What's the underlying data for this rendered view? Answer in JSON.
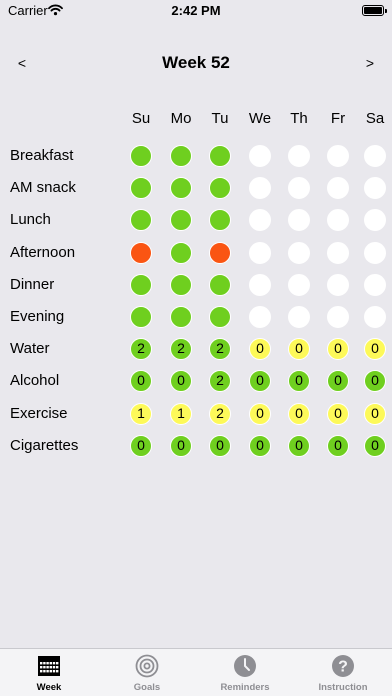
{
  "status_bar": {
    "carrier": "Carrier",
    "time": "2:42 PM"
  },
  "header": {
    "prev": "<",
    "title": "Week 52",
    "next": ">"
  },
  "days": [
    "Su",
    "Mo",
    "Tu",
    "We",
    "Th",
    "Fr",
    "Sa"
  ],
  "colors": {
    "green": "#6fcf1f",
    "red": "#fa5513",
    "yellow": "#fdf959",
    "empty": "#ffffff",
    "background": "#e9e8ed"
  },
  "rows": [
    {
      "label": "Breakfast",
      "cells": [
        {
          "s": "green",
          "v": ""
        },
        {
          "s": "green",
          "v": ""
        },
        {
          "s": "green",
          "v": ""
        },
        {
          "s": "empty",
          "v": ""
        },
        {
          "s": "empty",
          "v": ""
        },
        {
          "s": "empty",
          "v": ""
        },
        {
          "s": "empty",
          "v": ""
        }
      ]
    },
    {
      "label": "AM snack",
      "cells": [
        {
          "s": "green",
          "v": ""
        },
        {
          "s": "green",
          "v": ""
        },
        {
          "s": "green",
          "v": ""
        },
        {
          "s": "empty",
          "v": ""
        },
        {
          "s": "empty",
          "v": ""
        },
        {
          "s": "empty",
          "v": ""
        },
        {
          "s": "empty",
          "v": ""
        }
      ]
    },
    {
      "label": "Lunch",
      "cells": [
        {
          "s": "green",
          "v": ""
        },
        {
          "s": "green",
          "v": ""
        },
        {
          "s": "green",
          "v": ""
        },
        {
          "s": "empty",
          "v": ""
        },
        {
          "s": "empty",
          "v": ""
        },
        {
          "s": "empty",
          "v": ""
        },
        {
          "s": "empty",
          "v": ""
        }
      ]
    },
    {
      "label": "Afternoon",
      "cells": [
        {
          "s": "red",
          "v": ""
        },
        {
          "s": "green",
          "v": ""
        },
        {
          "s": "red",
          "v": ""
        },
        {
          "s": "empty",
          "v": ""
        },
        {
          "s": "empty",
          "v": ""
        },
        {
          "s": "empty",
          "v": ""
        },
        {
          "s": "empty",
          "v": ""
        }
      ]
    },
    {
      "label": "Dinner",
      "cells": [
        {
          "s": "green",
          "v": ""
        },
        {
          "s": "green",
          "v": ""
        },
        {
          "s": "green",
          "v": ""
        },
        {
          "s": "empty",
          "v": ""
        },
        {
          "s": "empty",
          "v": ""
        },
        {
          "s": "empty",
          "v": ""
        },
        {
          "s": "empty",
          "v": ""
        }
      ]
    },
    {
      "label": "Evening",
      "cells": [
        {
          "s": "green",
          "v": ""
        },
        {
          "s": "green",
          "v": ""
        },
        {
          "s": "green",
          "v": ""
        },
        {
          "s": "empty",
          "v": ""
        },
        {
          "s": "empty",
          "v": ""
        },
        {
          "s": "empty",
          "v": ""
        },
        {
          "s": "empty",
          "v": ""
        }
      ]
    },
    {
      "label": "Water",
      "cells": [
        {
          "s": "green",
          "v": "2"
        },
        {
          "s": "green",
          "v": "2"
        },
        {
          "s": "green",
          "v": "2"
        },
        {
          "s": "yellow",
          "v": "0"
        },
        {
          "s": "yellow",
          "v": "0"
        },
        {
          "s": "yellow",
          "v": "0"
        },
        {
          "s": "yellow",
          "v": "0"
        }
      ]
    },
    {
      "label": "Alcohol",
      "cells": [
        {
          "s": "green",
          "v": "0"
        },
        {
          "s": "green",
          "v": "0"
        },
        {
          "s": "green",
          "v": "2"
        },
        {
          "s": "green",
          "v": "0"
        },
        {
          "s": "green",
          "v": "0"
        },
        {
          "s": "green",
          "v": "0"
        },
        {
          "s": "green",
          "v": "0"
        }
      ]
    },
    {
      "label": "Exercise",
      "cells": [
        {
          "s": "yellow",
          "v": "1"
        },
        {
          "s": "yellow",
          "v": "1"
        },
        {
          "s": "yellow",
          "v": "2"
        },
        {
          "s": "yellow",
          "v": "0"
        },
        {
          "s": "yellow",
          "v": "0"
        },
        {
          "s": "yellow",
          "v": "0"
        },
        {
          "s": "yellow",
          "v": "0"
        }
      ]
    },
    {
      "label": "Cigarettes",
      "cells": [
        {
          "s": "green",
          "v": "0"
        },
        {
          "s": "green",
          "v": "0"
        },
        {
          "s": "green",
          "v": "0"
        },
        {
          "s": "green",
          "v": "0"
        },
        {
          "s": "green",
          "v": "0"
        },
        {
          "s": "green",
          "v": "0"
        },
        {
          "s": "green",
          "v": "0"
        }
      ]
    }
  ],
  "tabs": [
    {
      "label": "Week",
      "icon": "calendar-grid-icon",
      "active": true
    },
    {
      "label": "Goals",
      "icon": "target-icon",
      "active": false
    },
    {
      "label": "Reminders",
      "icon": "clock-icon",
      "active": false
    },
    {
      "label": "Instruction",
      "icon": "question-icon",
      "active": false
    }
  ]
}
